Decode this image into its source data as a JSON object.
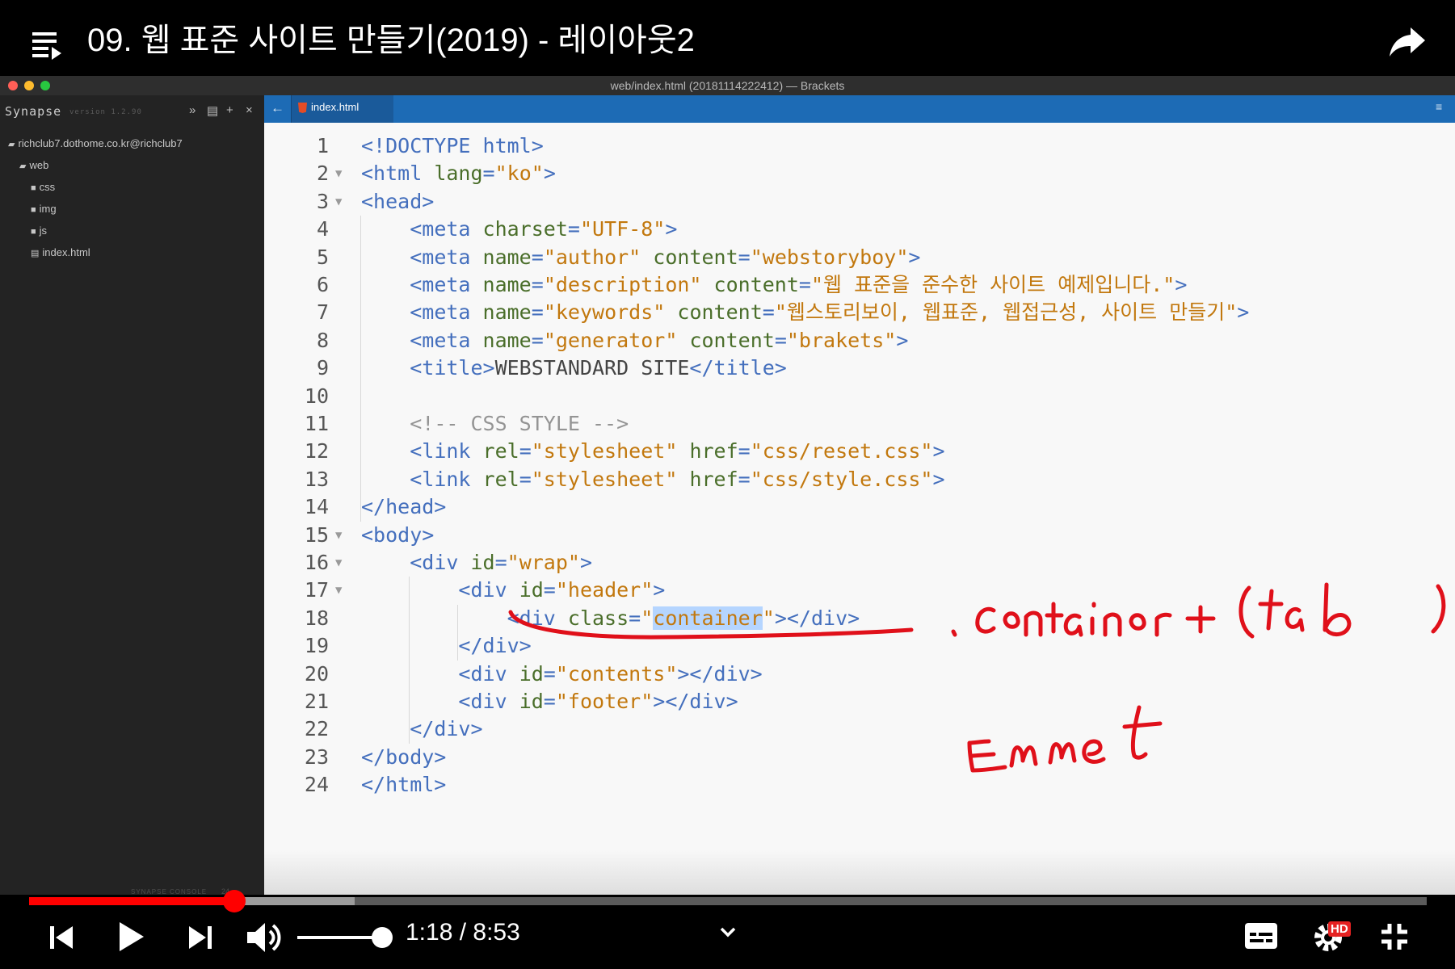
{
  "video": {
    "title": "09. 웹 표준 사이트 만들기(2019) - 레이아웃2",
    "time_current": "1:18",
    "time_separator": "/",
    "time_total": "8:53",
    "time_display": "1:18 / 8:53",
    "progress_fraction": 0.147,
    "buffered_fraction": 0.233,
    "volume_fraction": 0.9,
    "quality_badge": "HD",
    "icons": [
      "playlist-icon",
      "share-icon",
      "previous-icon",
      "play-icon",
      "next-icon",
      "volume-icon",
      "chevron-down-icon",
      "subtitles-icon",
      "settings-icon",
      "exit-fullscreen-icon"
    ]
  },
  "window": {
    "title": "web/index.html (20181114222412) — Brackets",
    "traffic_colors": [
      "#ff5f57",
      "#febc2e",
      "#28c840"
    ]
  },
  "sidebar": {
    "name": "Synapse",
    "version": "version 1.2.90",
    "buttons": [
      "»",
      "▤",
      "+",
      "×"
    ],
    "tree": [
      {
        "label": "richclub7.dothome.co.kr@richclub7",
        "type": "folder-open",
        "depth": 0
      },
      {
        "label": "web",
        "type": "folder-open",
        "depth": 1
      },
      {
        "label": "css",
        "type": "folder",
        "depth": 2
      },
      {
        "label": "img",
        "type": "folder",
        "depth": 2
      },
      {
        "label": "js",
        "type": "folder",
        "depth": 2
      },
      {
        "label": "index.html",
        "type": "file",
        "depth": 2
      }
    ],
    "console_label": "SYNAPSE CONSOLE",
    "console_count": "24"
  },
  "editor": {
    "tab_label": "index.html",
    "back_arrow": "←",
    "menu_glyph": "≡",
    "lines": [
      {
        "n": "1",
        "fold": false,
        "code": [
          [
            "t",
            "<!DOCTYPE html>"
          ]
        ]
      },
      {
        "n": "2",
        "fold": true,
        "code": [
          [
            "t",
            "<html "
          ],
          [
            "a",
            "lang"
          ],
          [
            "t",
            "="
          ],
          [
            "av",
            "\"ko\""
          ],
          [
            "t",
            ">"
          ]
        ]
      },
      {
        "n": "3",
        "fold": true,
        "code": [
          [
            "t",
            "<head>"
          ]
        ]
      },
      {
        "n": "4",
        "fold": false,
        "code": [
          [
            "tx",
            "    "
          ],
          [
            "t",
            "<meta "
          ],
          [
            "a",
            "charset"
          ],
          [
            "t",
            "="
          ],
          [
            "av",
            "\"UTF-8\""
          ],
          [
            "t",
            ">"
          ]
        ]
      },
      {
        "n": "5",
        "fold": false,
        "code": [
          [
            "tx",
            "    "
          ],
          [
            "t",
            "<meta "
          ],
          [
            "a",
            "name"
          ],
          [
            "t",
            "="
          ],
          [
            "av",
            "\"author\""
          ],
          [
            "tx",
            " "
          ],
          [
            "a",
            "content"
          ],
          [
            "t",
            "="
          ],
          [
            "av",
            "\"webstoryboy\""
          ],
          [
            "t",
            ">"
          ]
        ]
      },
      {
        "n": "6",
        "fold": false,
        "code": [
          [
            "tx",
            "    "
          ],
          [
            "t",
            "<meta "
          ],
          [
            "a",
            "name"
          ],
          [
            "t",
            "="
          ],
          [
            "av",
            "\"description\""
          ],
          [
            "tx",
            " "
          ],
          [
            "a",
            "content"
          ],
          [
            "t",
            "="
          ],
          [
            "av",
            "\"웹 표준을 준수한 사이트 예제입니다.\""
          ],
          [
            "t",
            ">"
          ]
        ]
      },
      {
        "n": "7",
        "fold": false,
        "code": [
          [
            "tx",
            "    "
          ],
          [
            "t",
            "<meta "
          ],
          [
            "a",
            "name"
          ],
          [
            "t",
            "="
          ],
          [
            "av",
            "\"keywords\""
          ],
          [
            "tx",
            " "
          ],
          [
            "a",
            "content"
          ],
          [
            "t",
            "="
          ],
          [
            "av",
            "\"웹스토리보이, 웹표준, 웹접근성, 사이트 만들기\""
          ],
          [
            "t",
            ">"
          ]
        ]
      },
      {
        "n": "8",
        "fold": false,
        "code": [
          [
            "tx",
            "    "
          ],
          [
            "t",
            "<meta "
          ],
          [
            "a",
            "name"
          ],
          [
            "t",
            "="
          ],
          [
            "av",
            "\"generator\""
          ],
          [
            "tx",
            " "
          ],
          [
            "a",
            "content"
          ],
          [
            "t",
            "="
          ],
          [
            "av",
            "\"brakets\""
          ],
          [
            "t",
            ">"
          ]
        ]
      },
      {
        "n": "9",
        "fold": false,
        "code": [
          [
            "tx",
            "    "
          ],
          [
            "t",
            "<title>"
          ],
          [
            "tx",
            "WEBSTANDARD SITE"
          ],
          [
            "t",
            "</title>"
          ]
        ]
      },
      {
        "n": "10",
        "fold": false,
        "code": []
      },
      {
        "n": "11",
        "fold": false,
        "code": [
          [
            "tx",
            "    "
          ],
          [
            "cm",
            "<!-- CSS STYLE -->"
          ]
        ]
      },
      {
        "n": "12",
        "fold": false,
        "code": [
          [
            "tx",
            "    "
          ],
          [
            "t",
            "<link "
          ],
          [
            "a",
            "rel"
          ],
          [
            "t",
            "="
          ],
          [
            "av",
            "\"stylesheet\""
          ],
          [
            "tx",
            " "
          ],
          [
            "a",
            "href"
          ],
          [
            "t",
            "="
          ],
          [
            "av",
            "\"css/reset.css\""
          ],
          [
            "t",
            ">"
          ]
        ]
      },
      {
        "n": "13",
        "fold": false,
        "code": [
          [
            "tx",
            "    "
          ],
          [
            "t",
            "<link "
          ],
          [
            "a",
            "rel"
          ],
          [
            "t",
            "="
          ],
          [
            "av",
            "\"stylesheet\""
          ],
          [
            "tx",
            " "
          ],
          [
            "a",
            "href"
          ],
          [
            "t",
            "="
          ],
          [
            "av",
            "\"css/style.css\""
          ],
          [
            "t",
            ">"
          ]
        ]
      },
      {
        "n": "14",
        "fold": false,
        "code": [
          [
            "t",
            "</head>"
          ]
        ]
      },
      {
        "n": "15",
        "fold": true,
        "code": [
          [
            "t",
            "<body>"
          ]
        ]
      },
      {
        "n": "16",
        "fold": true,
        "code": [
          [
            "tx",
            "    "
          ],
          [
            "t",
            "<div "
          ],
          [
            "a",
            "id"
          ],
          [
            "t",
            "="
          ],
          [
            "av",
            "\"wrap\""
          ],
          [
            "t",
            ">"
          ]
        ]
      },
      {
        "n": "17",
        "fold": true,
        "code": [
          [
            "tx",
            "        "
          ],
          [
            "t",
            "<div "
          ],
          [
            "a",
            "id"
          ],
          [
            "t",
            "="
          ],
          [
            "av",
            "\"header\""
          ],
          [
            "t",
            ">"
          ]
        ]
      },
      {
        "n": "18",
        "fold": false,
        "code": [
          [
            "tx",
            "            "
          ],
          [
            "t",
            "<div "
          ],
          [
            "a",
            "class"
          ],
          [
            "t",
            "="
          ],
          [
            "av",
            "\""
          ],
          [
            "hl",
            "container"
          ],
          [
            "av",
            "\""
          ],
          [
            "t",
            "></div>"
          ]
        ]
      },
      {
        "n": "19",
        "fold": false,
        "code": [
          [
            "tx",
            "        "
          ],
          [
            "t",
            "</div>"
          ]
        ]
      },
      {
        "n": "20",
        "fold": false,
        "code": [
          [
            "tx",
            "        "
          ],
          [
            "t",
            "<div "
          ],
          [
            "a",
            "id"
          ],
          [
            "t",
            "="
          ],
          [
            "av",
            "\"contents\""
          ],
          [
            "t",
            "></div>"
          ]
        ]
      },
      {
        "n": "21",
        "fold": false,
        "code": [
          [
            "tx",
            "        "
          ],
          [
            "t",
            "<div "
          ],
          [
            "a",
            "id"
          ],
          [
            "t",
            "="
          ],
          [
            "av",
            "\"footer\""
          ],
          [
            "t",
            "></div>"
          ]
        ]
      },
      {
        "n": "22",
        "fold": false,
        "code": [
          [
            "tx",
            "    "
          ],
          [
            "t",
            "</div>"
          ]
        ]
      },
      {
        "n": "23",
        "fold": false,
        "code": [
          [
            "t",
            "</body>"
          ]
        ]
      },
      {
        "n": "24",
        "fold": false,
        "code": [
          [
            "t",
            "</html>"
          ]
        ]
      }
    ]
  },
  "annotations": {
    "ink_color": "#e0101a",
    "text_line1": ".container + (tab)",
    "text_line2": "Emmet"
  }
}
